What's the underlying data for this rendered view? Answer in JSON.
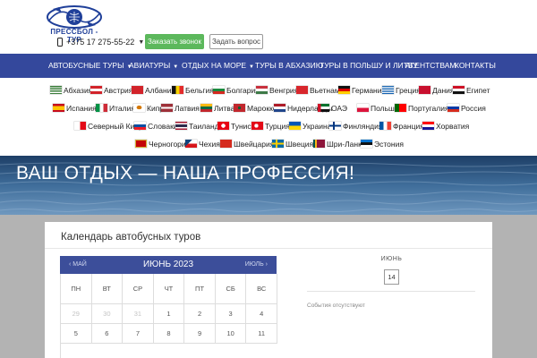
{
  "header": {
    "logo_text": "ПРЕССБОЛ - ТУР",
    "phone": "+375 17 275-55-22",
    "callback_label": "Заказать звонок",
    "question_label": "Задать вопрос"
  },
  "nav": {
    "items": [
      {
        "label": "АВТОБУСНЫЕ ТУРЫ",
        "has_dropdown": true
      },
      {
        "label": "АВИАТУРЫ",
        "has_dropdown": true
      },
      {
        "label": "ОТДЫХ НА МОРЕ",
        "has_dropdown": true
      },
      {
        "label": "ТУРЫ В АБХАЗИЮ",
        "has_dropdown": false
      },
      {
        "label": "ТУРЫ В ПОЛЬШУ И ЛИТВУ",
        "has_dropdown": false
      },
      {
        "label": "АГЕНТСТВАМ",
        "has_dropdown": false
      },
      {
        "label": "КОНТАКТЫ",
        "has_dropdown": false
      }
    ]
  },
  "countries": [
    {
      "label": "Абхазия"
    },
    {
      "label": "Австрия"
    },
    {
      "label": "Албания"
    },
    {
      "label": "Бельгия"
    },
    {
      "label": "Болгария"
    },
    {
      "label": "Венгрия"
    },
    {
      "label": "Вьетнам"
    },
    {
      "label": "Германия"
    },
    {
      "label": "Греция"
    },
    {
      "label": "Дания"
    },
    {
      "label": "Египет"
    },
    {
      "label": "Испания"
    },
    {
      "label": "Италия"
    },
    {
      "label": "Кипр"
    },
    {
      "label": "Латвия"
    },
    {
      "label": "Литва"
    },
    {
      "label": "Марокко"
    },
    {
      "label": "Нидерланды"
    },
    {
      "label": "ОАЭ"
    },
    {
      "label": "Польша"
    },
    {
      "label": "Португалия"
    },
    {
      "label": "Россия"
    },
    {
      "label": "Северный Кипр"
    },
    {
      "label": "Словакия"
    },
    {
      "label": "Таиланд"
    },
    {
      "label": "Тунис"
    },
    {
      "label": "Турция"
    },
    {
      "label": "Украина"
    },
    {
      "label": "Финляндия"
    },
    {
      "label": "Франция"
    },
    {
      "label": "Хорватия"
    },
    {
      "label": "Черногория"
    },
    {
      "label": "Чехия"
    },
    {
      "label": "Швейцария"
    },
    {
      "label": "Швеция"
    },
    {
      "label": "Шри-Ланка"
    },
    {
      "label": "Эстония"
    }
  ],
  "hero": {
    "title": "ВАШ ОТДЫХ — НАША ПРОФЕССИЯ!"
  },
  "calendar": {
    "title": "Календарь автобусных туров",
    "prev": "МАЙ",
    "month": "ИЮНЬ 2023",
    "next": "ИЮЛЬ",
    "weekdays": [
      "ПН",
      "ВТ",
      "СР",
      "ЧТ",
      "ПТ",
      "СБ",
      "ВС"
    ],
    "rows": [
      [
        "29",
        "30",
        "31",
        "1",
        "2",
        "3",
        "4"
      ],
      [
        "5",
        "6",
        "7",
        "8",
        "9",
        "10",
        "11"
      ]
    ],
    "muted_days": [
      "29",
      "30",
      "31"
    ]
  },
  "side": {
    "month": "ИЮНЬ",
    "day": "14",
    "no_events": "События отсутствуют"
  },
  "colors": {
    "nav_bg": "#34489c",
    "calendar_head": "#3c4e9a",
    "callback_btn": "#5cb85c",
    "brand_text": "#1f3f99"
  }
}
